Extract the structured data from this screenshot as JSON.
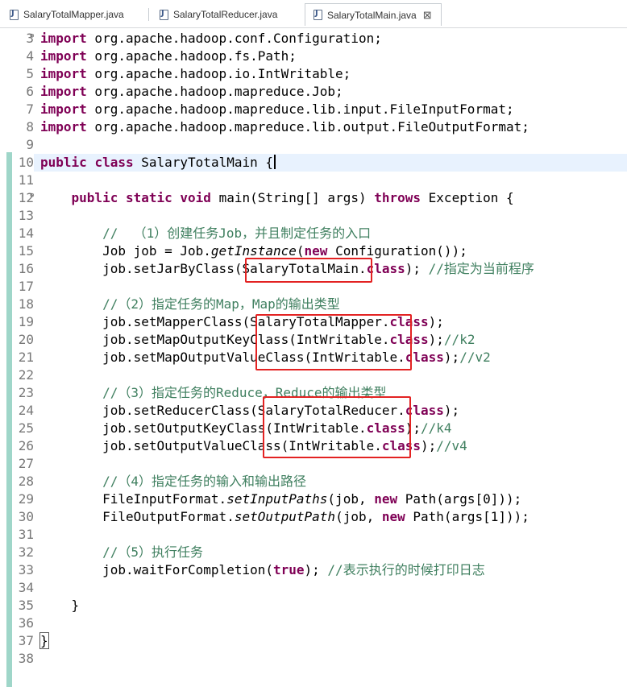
{
  "tabs": [
    {
      "label": "SalaryTotalMapper.java"
    },
    {
      "label": "SalaryTotalReducer.java"
    },
    {
      "label": "SalaryTotalMain.java",
      "close": "⊠"
    }
  ],
  "lines": [
    {
      "n": "3",
      "t": [
        [
          "kw",
          "import"
        ],
        [
          "n",
          " org.apache.hadoop.conf.Configuration;"
        ]
      ]
    },
    {
      "n": "4",
      "t": [
        [
          "kw",
          "import"
        ],
        [
          "n",
          " org.apache.hadoop.fs.Path;"
        ]
      ]
    },
    {
      "n": "5",
      "t": [
        [
          "kw",
          "import"
        ],
        [
          "n",
          " org.apache.hadoop.io.IntWritable;"
        ]
      ]
    },
    {
      "n": "6",
      "t": [
        [
          "kw",
          "import"
        ],
        [
          "n",
          " org.apache.hadoop.mapreduce.Job;"
        ]
      ]
    },
    {
      "n": "7",
      "t": [
        [
          "kw",
          "import"
        ],
        [
          "n",
          " org.apache.hadoop.mapreduce.lib.input.FileInputFormat;"
        ]
      ]
    },
    {
      "n": "8",
      "t": [
        [
          "kw",
          "import"
        ],
        [
          "n",
          " org.apache.hadoop.mapreduce.lib.output.FileOutputFormat;"
        ]
      ]
    },
    {
      "n": "9",
      "t": []
    },
    {
      "n": "10",
      "t": [
        [
          "kw",
          "public"
        ],
        [
          "n",
          " "
        ],
        [
          "kw",
          "class"
        ],
        [
          "n",
          " SalaryTotalMain {"
        ]
      ]
    },
    {
      "n": "11",
      "t": []
    },
    {
      "n": "12",
      "t": [
        [
          "n",
          "    "
        ],
        [
          "kw",
          "public"
        ],
        [
          "n",
          " "
        ],
        [
          "kw",
          "static"
        ],
        [
          "n",
          " "
        ],
        [
          "kw",
          "void"
        ],
        [
          "n",
          " main(String[] args) "
        ],
        [
          "kw",
          "throws"
        ],
        [
          "n",
          " Exception {"
        ]
      ]
    },
    {
      "n": "13",
      "t": []
    },
    {
      "n": "14",
      "t": [
        [
          "n",
          "        "
        ],
        [
          "cm",
          "//  （1）创建任务Job，并且制定任务的入口"
        ]
      ]
    },
    {
      "n": "15",
      "t": [
        [
          "n",
          "        Job job = Job."
        ],
        [
          "it",
          "getInstance"
        ],
        [
          "n",
          "("
        ],
        [
          "kw",
          "new"
        ],
        [
          "n",
          " Configuration());"
        ]
      ]
    },
    {
      "n": "16",
      "t": [
        [
          "n",
          "        job.setJarByClass(SalaryTotalMain."
        ],
        [
          "kw",
          "class"
        ],
        [
          "n",
          "); "
        ],
        [
          "cm",
          "//指定为当前程序"
        ]
      ]
    },
    {
      "n": "17",
      "t": []
    },
    {
      "n": "18",
      "t": [
        [
          "n",
          "        "
        ],
        [
          "cm",
          "//（2）指定任务的Map，Map的输出类型"
        ]
      ]
    },
    {
      "n": "19",
      "t": [
        [
          "n",
          "        job.setMapperClass(SalaryTotalMapper."
        ],
        [
          "kw",
          "class"
        ],
        [
          "n",
          ");"
        ]
      ]
    },
    {
      "n": "20",
      "t": [
        [
          "n",
          "        job.setMapOutputKeyClass(IntWritable."
        ],
        [
          "kw",
          "class"
        ],
        [
          "n",
          ");"
        ],
        [
          "cm",
          "//k2"
        ]
      ]
    },
    {
      "n": "21",
      "t": [
        [
          "n",
          "        job.setMapOutputValueClass(IntWritable."
        ],
        [
          "kw",
          "class"
        ],
        [
          "n",
          ");"
        ],
        [
          "cm",
          "//v2"
        ]
      ]
    },
    {
      "n": "22",
      "t": []
    },
    {
      "n": "23",
      "t": [
        [
          "n",
          "        "
        ],
        [
          "cm",
          "//（3）指定任务的Reduce，Reduce的输出类型"
        ]
      ]
    },
    {
      "n": "24",
      "t": [
        [
          "n",
          "        job.setReducerClass(SalaryTotalReducer."
        ],
        [
          "kw",
          "class"
        ],
        [
          "n",
          ");"
        ]
      ]
    },
    {
      "n": "25",
      "t": [
        [
          "n",
          "        job.setOutputKeyClass(IntWritable."
        ],
        [
          "kw",
          "class"
        ],
        [
          "n",
          ");"
        ],
        [
          "cm",
          "//k4"
        ]
      ]
    },
    {
      "n": "26",
      "t": [
        [
          "n",
          "        job.setOutputValueClass(IntWritable."
        ],
        [
          "kw",
          "class"
        ],
        [
          "n",
          ");"
        ],
        [
          "cm",
          "//v4"
        ]
      ]
    },
    {
      "n": "27",
      "t": []
    },
    {
      "n": "28",
      "t": [
        [
          "n",
          "        "
        ],
        [
          "cm",
          "//（4）指定任务的输入和输出路径"
        ]
      ]
    },
    {
      "n": "29",
      "t": [
        [
          "n",
          "        FileInputFormat."
        ],
        [
          "it",
          "setInputPaths"
        ],
        [
          "n",
          "(job, "
        ],
        [
          "kw",
          "new"
        ],
        [
          "n",
          " Path(args[0]));"
        ]
      ]
    },
    {
      "n": "30",
      "t": [
        [
          "n",
          "        FileOutputFormat."
        ],
        [
          "it",
          "setOutputPath"
        ],
        [
          "n",
          "(job, "
        ],
        [
          "kw",
          "new"
        ],
        [
          "n",
          " Path(args[1]));"
        ]
      ]
    },
    {
      "n": "31",
      "t": []
    },
    {
      "n": "32",
      "t": [
        [
          "n",
          "        "
        ],
        [
          "cm",
          "//（5）执行任务"
        ]
      ]
    },
    {
      "n": "33",
      "t": [
        [
          "n",
          "        job.waitForCompletion("
        ],
        [
          "kw",
          "true"
        ],
        [
          "n",
          "); "
        ],
        [
          "cm",
          "//表示执行的时候打印日志"
        ]
      ]
    },
    {
      "n": "34",
      "t": []
    },
    {
      "n": "35",
      "t": [
        [
          "n",
          "    }"
        ]
      ]
    },
    {
      "n": "36",
      "t": []
    },
    {
      "n": "37",
      "t": [
        [
          "n",
          "}"
        ]
      ]
    },
    {
      "n": "38",
      "t": []
    }
  ],
  "colors": {
    "keyword": "#7f0055",
    "comment": "#3f7f5f",
    "highlight": "#e32222"
  }
}
